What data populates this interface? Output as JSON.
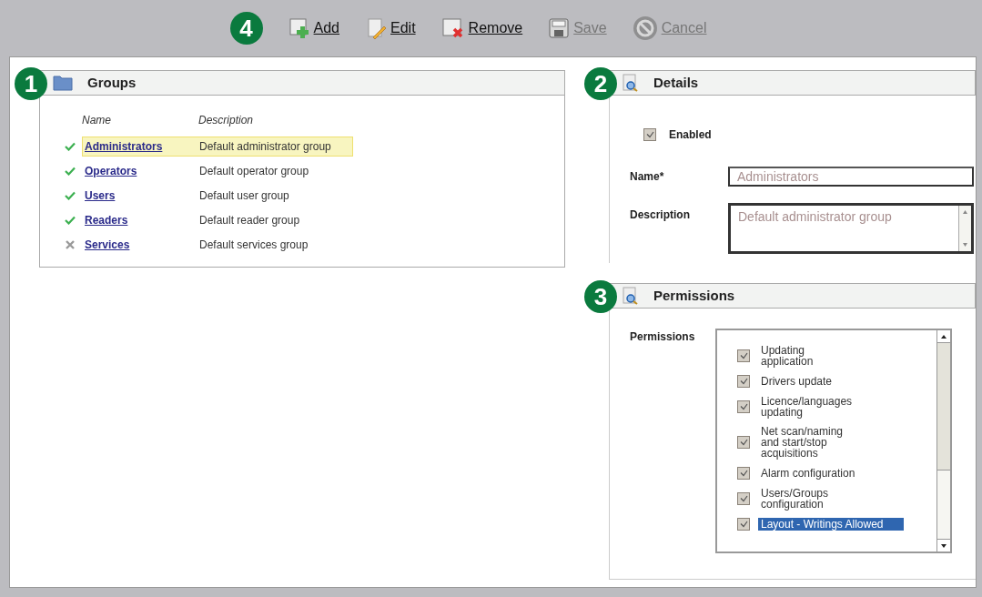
{
  "toolbar": {
    "badge": "4",
    "buttons": [
      {
        "kind": "add",
        "label": "Add",
        "disabled": false
      },
      {
        "kind": "edit",
        "label": "Edit",
        "disabled": false
      },
      {
        "kind": "remove",
        "label": "Remove",
        "disabled": false
      },
      {
        "kind": "save",
        "label": "Save",
        "disabled": true
      },
      {
        "kind": "cancel",
        "label": "Cancel",
        "disabled": true
      }
    ]
  },
  "groups": {
    "badge": "1",
    "title": "Groups",
    "columns": [
      "Name",
      "Description"
    ],
    "rows": [
      {
        "name": "Administrators",
        "description": "Default administrator group",
        "enabled": true,
        "selected": true
      },
      {
        "name": "Operators",
        "description": "Default operator group",
        "enabled": true,
        "selected": false
      },
      {
        "name": "Users",
        "description": "Default user group",
        "enabled": true,
        "selected": false
      },
      {
        "name": "Readers",
        "description": "Default reader group",
        "enabled": true,
        "selected": false
      },
      {
        "name": "Services",
        "description": "Default services group",
        "enabled": false,
        "selected": false
      }
    ]
  },
  "details": {
    "badge": "2",
    "title": "Details",
    "enabled": {
      "label": "Enabled",
      "checked": true
    },
    "name": {
      "label": "Name*",
      "value": "Administrators"
    },
    "description": {
      "label": "Description",
      "value": "Default administrator group"
    }
  },
  "permissions": {
    "badge": "3",
    "title": "Permissions",
    "label": "Permissions",
    "items": [
      {
        "label": "Updating\napplication",
        "checked": true,
        "selected": false
      },
      {
        "label": "Drivers update",
        "checked": true,
        "selected": false
      },
      {
        "label": "Licence/languages\nupdating",
        "checked": true,
        "selected": false
      },
      {
        "label": "Net scan/naming\nand start/stop\nacquisitions",
        "checked": true,
        "selected": false
      },
      {
        "label": "Alarm configuration",
        "checked": true,
        "selected": false
      },
      {
        "label": "Users/Groups\nconfiguration",
        "checked": true,
        "selected": false
      },
      {
        "label": "Layout - Writings Allowed",
        "checked": true,
        "selected": true
      }
    ]
  }
}
